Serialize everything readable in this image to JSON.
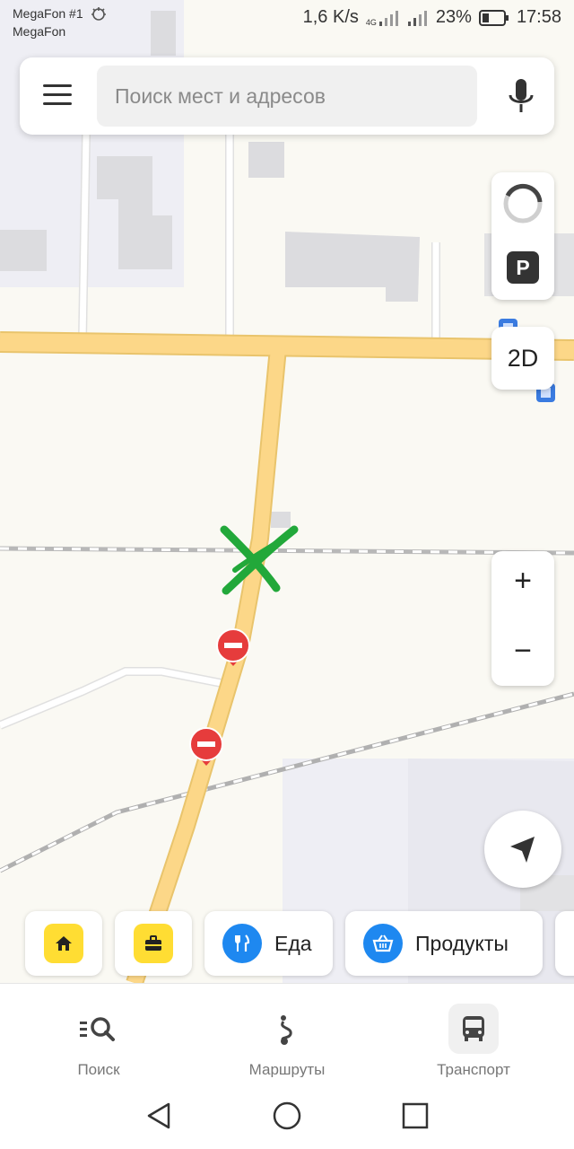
{
  "status_bar": {
    "carrier_1": "MegaFon #1",
    "carrier_2": "MegaFon",
    "net_speed": "1,6 K/s",
    "network_type": "4G",
    "battery": "23%",
    "time": "17:58"
  },
  "search": {
    "placeholder": "Поиск мест и адресов",
    "menu_icon": "hamburger-menu-icon",
    "mic_icon": "microphone-icon"
  },
  "map_controls": {
    "traffic_icon": "traffic-ring-icon",
    "parking_label": "P",
    "view_mode_label": "2D",
    "zoom_in_label": "+",
    "zoom_out_label": "−",
    "locate_icon": "navigation-arrow-icon"
  },
  "map": {
    "road_color": "#fcd788",
    "building_color": "#dcdcdf",
    "marker_color": "#e63c3c",
    "cross_mark_color": "#22a83a"
  },
  "chips": [
    {
      "icon": "home-icon",
      "label": ""
    },
    {
      "icon": "briefcase-icon",
      "label": ""
    },
    {
      "icon": "fork-knife-icon",
      "label": "Еда"
    },
    {
      "icon": "basket-icon",
      "label": "Продукты"
    }
  ],
  "bottom_nav": [
    {
      "icon": "search-list-icon",
      "label": "Поиск"
    },
    {
      "icon": "route-icon",
      "label": "Маршруты"
    },
    {
      "icon": "bus-icon",
      "label": "Транспорт"
    }
  ],
  "system_nav": {
    "back_icon": "back-triangle-icon",
    "home_icon": "home-circle-icon",
    "recents_icon": "recents-square-icon"
  }
}
